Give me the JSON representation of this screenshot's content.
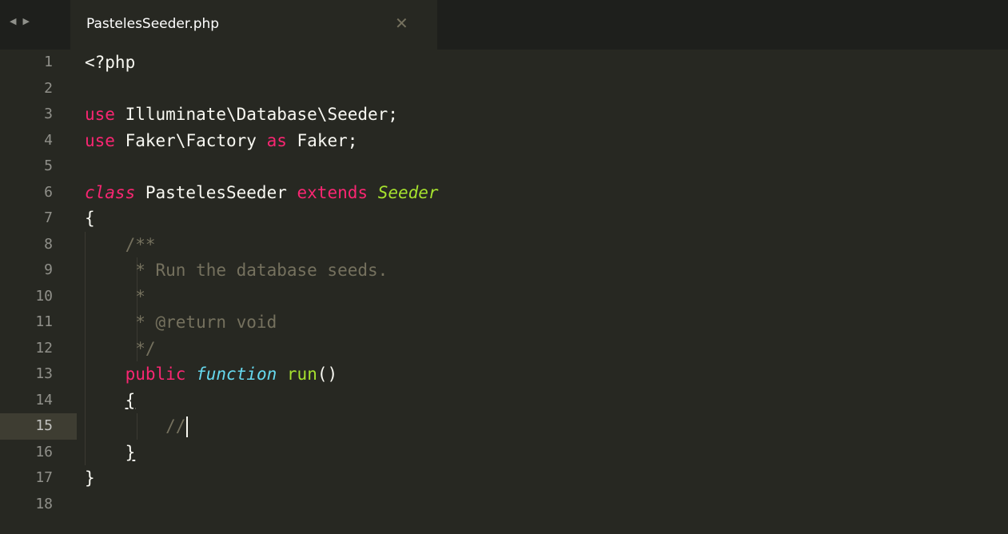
{
  "tabbar": {
    "back_arrow": "◀",
    "forward_arrow": "▶",
    "tab_title": "PastelesSeeder.php",
    "close_glyph": "✕"
  },
  "editor": {
    "current_line": 15,
    "lines": [
      {
        "n": "1",
        "segs": [
          {
            "t": "<?php",
            "c": ""
          }
        ]
      },
      {
        "n": "2",
        "segs": []
      },
      {
        "n": "3",
        "segs": [
          {
            "t": "use",
            "c": "kw"
          },
          {
            "t": " Illuminate\\Database\\Seeder;",
            "c": ""
          }
        ]
      },
      {
        "n": "4",
        "segs": [
          {
            "t": "use",
            "c": "kw"
          },
          {
            "t": " Faker\\Factory ",
            "c": ""
          },
          {
            "t": "as",
            "c": "kw"
          },
          {
            "t": " Faker;",
            "c": ""
          }
        ]
      },
      {
        "n": "5",
        "segs": []
      },
      {
        "n": "6",
        "segs": [
          {
            "t": "class",
            "c": "stor-kw"
          },
          {
            "t": " PastelesSeeder ",
            "c": ""
          },
          {
            "t": "extends",
            "c": "kw"
          },
          {
            "t": " ",
            "c": ""
          },
          {
            "t": "Seeder",
            "c": "cls"
          }
        ]
      },
      {
        "n": "7",
        "segs": [
          {
            "t": "{",
            "c": ""
          }
        ]
      },
      {
        "n": "8",
        "segs": [
          {
            "t": "    /**",
            "c": "cmt"
          }
        ]
      },
      {
        "n": "9",
        "segs": [
          {
            "t": "     * Run the database seeds.",
            "c": "cmt"
          }
        ]
      },
      {
        "n": "10",
        "segs": [
          {
            "t": "     *",
            "c": "cmt"
          }
        ]
      },
      {
        "n": "11",
        "segs": [
          {
            "t": "     * @return void",
            "c": "cmt"
          }
        ]
      },
      {
        "n": "12",
        "segs": [
          {
            "t": "     */",
            "c": "cmt"
          }
        ]
      },
      {
        "n": "13",
        "segs": [
          {
            "t": "    ",
            "c": ""
          },
          {
            "t": "public",
            "c": "kw"
          },
          {
            "t": " ",
            "c": ""
          },
          {
            "t": "function",
            "c": "stor"
          },
          {
            "t": " ",
            "c": ""
          },
          {
            "t": "run",
            "c": "fn"
          },
          {
            "t": "()",
            "c": ""
          }
        ]
      },
      {
        "n": "14",
        "segs": [
          {
            "t": "    ",
            "c": ""
          },
          {
            "t": "{",
            "c": "ul"
          }
        ]
      },
      {
        "n": "15",
        "segs": [
          {
            "t": "        //",
            "c": "cmt"
          }
        ]
      },
      {
        "n": "16",
        "segs": [
          {
            "t": "    ",
            "c": ""
          },
          {
            "t": "}",
            "c": "ul"
          }
        ]
      },
      {
        "n": "17",
        "segs": [
          {
            "t": "}",
            "c": ""
          }
        ]
      },
      {
        "n": "18",
        "segs": []
      }
    ]
  },
  "colors": {
    "background": "#272822",
    "keyword": "#f92672",
    "storage": "#66d9ef",
    "class_name": "#a6e22e",
    "comment": "#75715e",
    "text": "#f8f8f2"
  }
}
